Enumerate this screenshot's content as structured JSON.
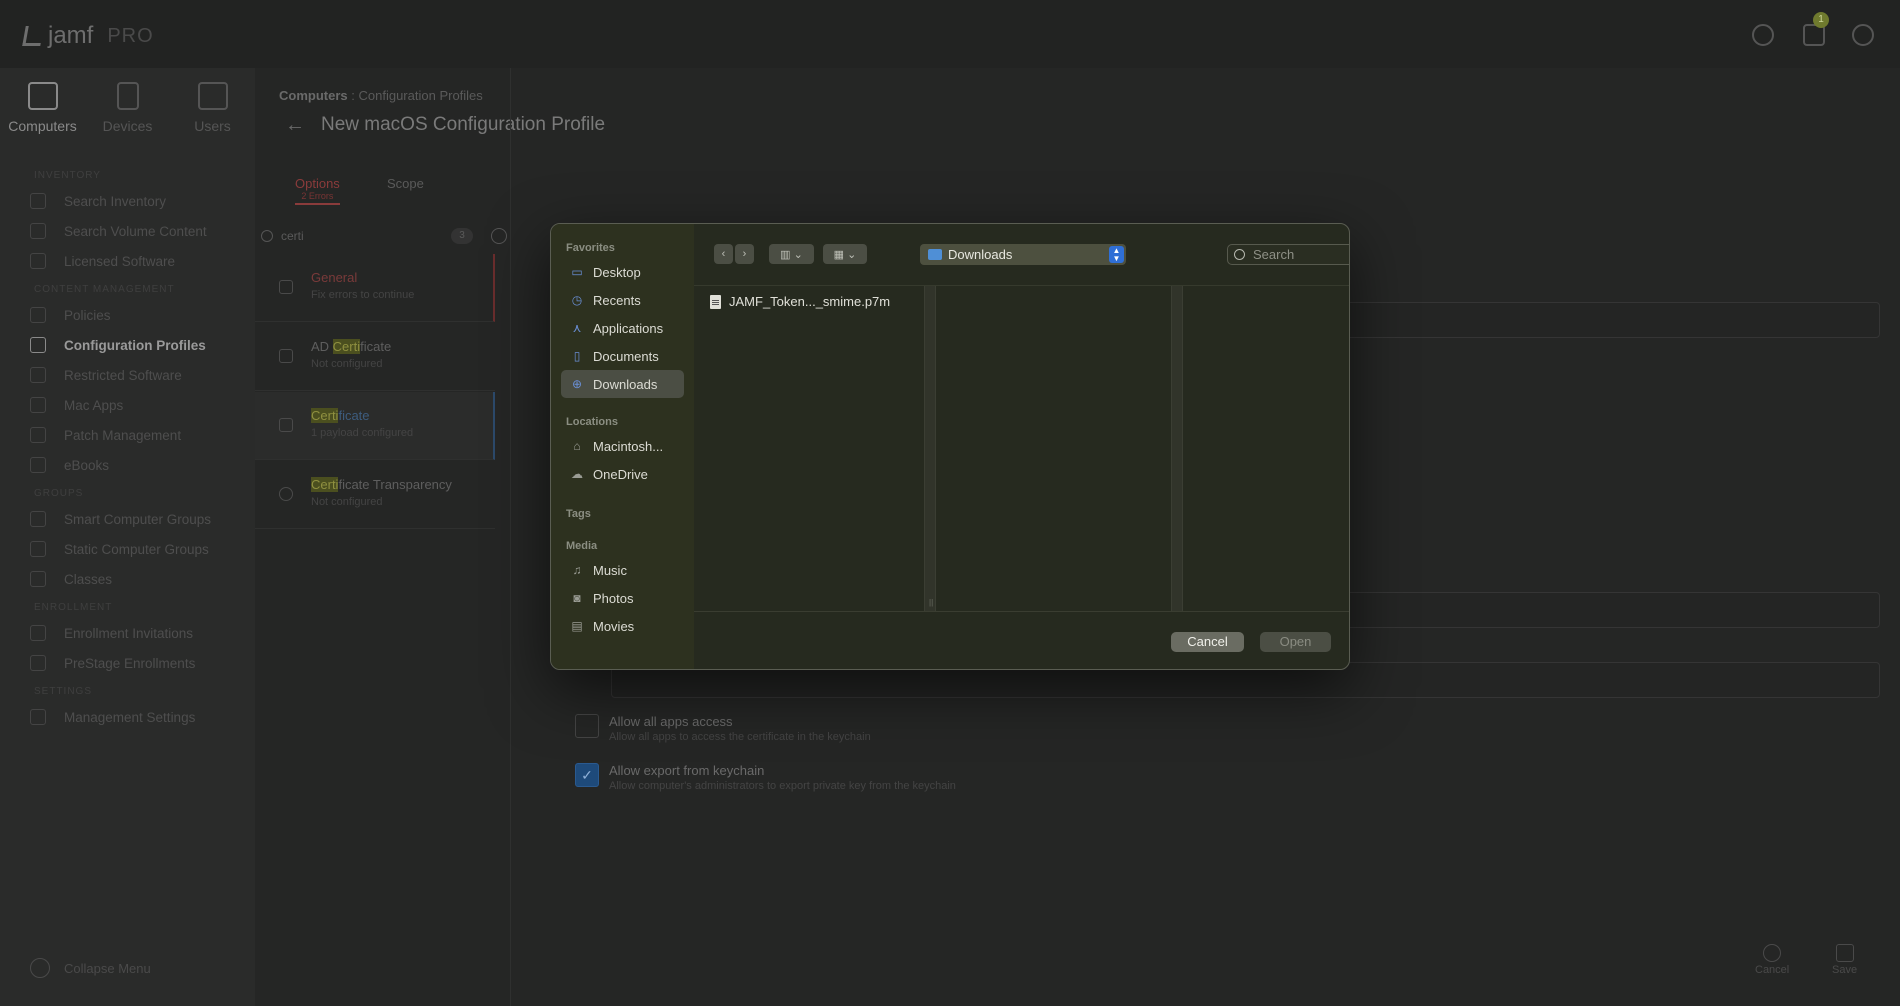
{
  "app": {
    "brand": "jamf",
    "brand_suffix": "PRO",
    "notification_count": "1"
  },
  "nav": {
    "tabs": [
      {
        "label": "Computers"
      },
      {
        "label": "Devices"
      },
      {
        "label": "Users"
      }
    ],
    "section_inventory": "INVENTORY",
    "section_content": "CONTENT MANAGEMENT",
    "section_groups": "GROUPS",
    "section_enrollment": "ENROLLMENT",
    "section_settings": "SETTINGS",
    "inventory": [
      "Search Inventory",
      "Search Volume Content",
      "Licensed Software"
    ],
    "content": [
      "Policies",
      "Configuration Profiles",
      "Restricted Software",
      "Mac Apps",
      "Patch Management",
      "eBooks"
    ],
    "groups": [
      "Smart Computer Groups",
      "Static Computer Groups",
      "Classes"
    ],
    "enrollment": [
      "Enrollment Invitations",
      "PreStage Enrollments"
    ],
    "settings": [
      "Management Settings"
    ],
    "collapse": "Collapse Menu"
  },
  "main": {
    "breadcrumb_root": "Computers",
    "breadcrumb_sep": ":",
    "breadcrumb_current": "Configuration Profiles",
    "title": "New macOS Configuration Profile",
    "tab_options": "Options",
    "tab_options_errors": "2 Errors",
    "tab_scope": "Scope",
    "search_value": "certi",
    "search_count": "3",
    "payloads": [
      {
        "title": "General",
        "subtitle": "Fix errors to continue"
      },
      {
        "title_pre": "AD ",
        "title_hl": "Certi",
        "title_post": "ficate",
        "subtitle": "Not configured"
      },
      {
        "title_pre": "",
        "title_hl": "Certi",
        "title_post": "ficate",
        "subtitle": "1 payload configured"
      },
      {
        "title_pre": "",
        "title_hl": "Certi",
        "title_post": "ficate Transparency",
        "subtitle": "Not configured"
      }
    ],
    "allow_apps_title": "Allow all apps access",
    "allow_apps_sub": "Allow all apps to access the certificate in the keychain",
    "allow_export_title": "Allow export from keychain",
    "allow_export_sub": "Allow computer's administrators to export private key from the keychain",
    "allow_export_checked": "✓",
    "cancel": "Cancel",
    "save": "Save"
  },
  "dialog": {
    "favorites_label": "Favorites",
    "favorites": [
      "Desktop",
      "Recents",
      "Applications",
      "Documents",
      "Downloads"
    ],
    "locations_label": "Locations",
    "locations": [
      "Macintosh...",
      "OneDrive"
    ],
    "tags_label": "Tags",
    "media_label": "Media",
    "media": [
      "Music",
      "Photos",
      "Movies"
    ],
    "location": "Downloads",
    "search_placeholder": "Search",
    "file": "JAMF_Token..._smime.p7m",
    "cancel": "Cancel",
    "open": "Open"
  }
}
